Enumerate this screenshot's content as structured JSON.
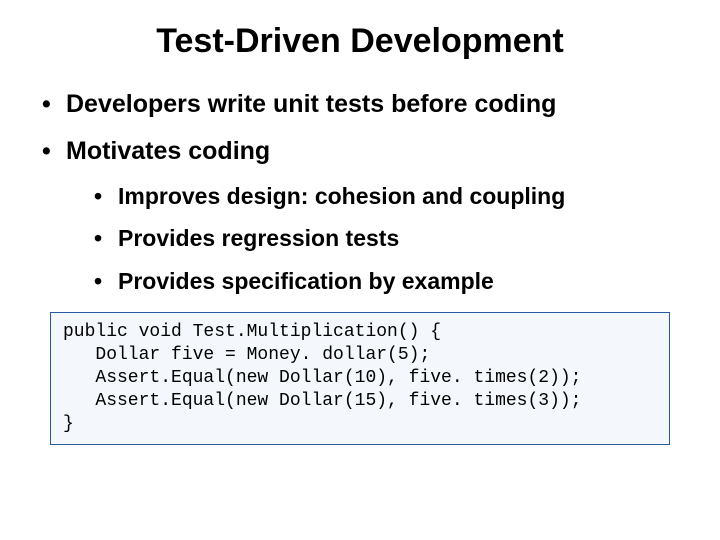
{
  "title": "Test-Driven Development",
  "bullets": [
    {
      "text": "Developers write unit tests before coding"
    },
    {
      "text": "Motivates coding",
      "sub": [
        "Improves design: cohesion and coupling",
        "Provides regression tests",
        "Provides specification by example"
      ]
    }
  ],
  "code": "public void Test.Multiplication() {\n   Dollar five = Money. dollar(5);\n   Assert.Equal(new Dollar(10), five. times(2));\n   Assert.Equal(new Dollar(15), five. times(3));\n}",
  "colors": {
    "code_bg": "#f4f8fc",
    "code_border": "#2a5aa0"
  }
}
